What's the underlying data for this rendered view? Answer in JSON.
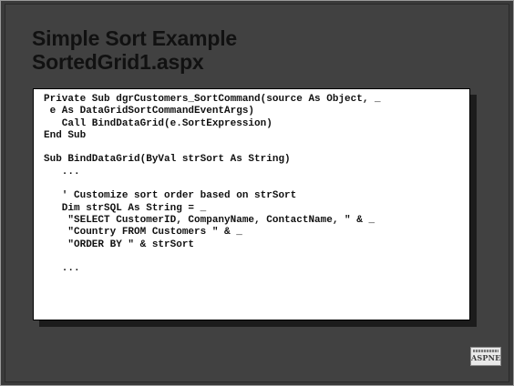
{
  "slide": {
    "title_lines": [
      "Simple Sort Example",
      "SortedGrid1.aspx"
    ],
    "code_lines": [
      "Private Sub dgrCustomers_SortCommand(source As Object, _",
      " e As DataGridSortCommandEventArgs)",
      "   Call BindDataGrid(e.SortExpression)",
      "End Sub",
      "",
      "Sub BindDataGrid(ByVal strSort As String)",
      "   ...",
      "",
      "   ' Customize sort order based on strSort",
      "   Dim strSQL As String = _",
      "    \"SELECT CustomerID, CompanyName, ContactName, \" & _",
      "    \"Country FROM Customers \" & _",
      "    \"ORDER BY \" & strSort",
      "",
      "   ..."
    ],
    "logo_text": "ASPNET"
  },
  "colors": {
    "slide_background": "#414141",
    "title_text": "#111111",
    "code_background": "#ffffff",
    "code_shadow": "#1c1c1c"
  },
  "icons": {
    "logo": "aspnet-logo-icon"
  }
}
